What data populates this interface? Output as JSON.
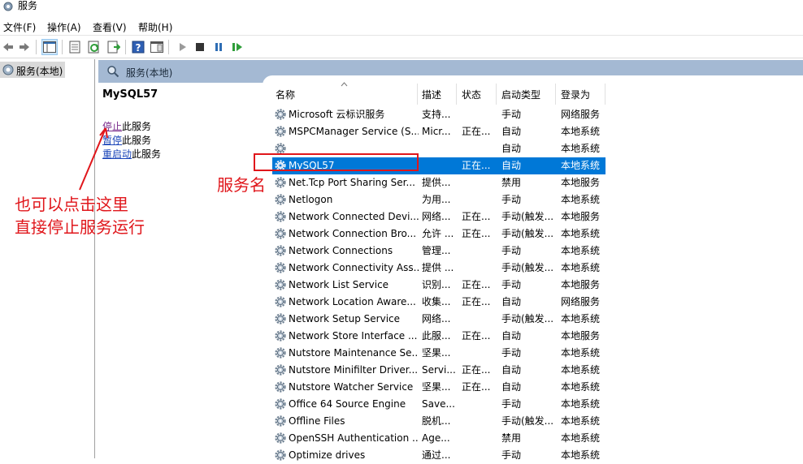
{
  "window": {
    "title": "服务"
  },
  "menu": [
    "文件(F)",
    "操作(A)",
    "查看(V)",
    "帮助(H)"
  ],
  "toolbar": {
    "icons": [
      "back-arrow-icon",
      "forward-arrow-icon",
      "show-tree-icon",
      "properties-icon",
      "refresh-icon",
      "export-icon",
      "help-icon",
      "console-icon",
      "start-icon",
      "stop-icon",
      "pause-icon",
      "restart-icon"
    ]
  },
  "tree": {
    "node_label": "服务(本地)"
  },
  "content_header": {
    "label": "服务(本地)"
  },
  "description": {
    "service_name": "MySQL57",
    "stop_link": "停止",
    "stop_suffix": "此服务",
    "pause_link": "暂停",
    "pause_suffix": "此服务",
    "restart_link": "重启动",
    "restart_suffix": "此服务"
  },
  "columns": [
    "名称",
    "描述",
    "状态",
    "启动类型",
    "登录为"
  ],
  "rows": [
    {
      "name": "Microsoft 云标识服务",
      "desc": "支持...",
      "status": "",
      "startup": "手动",
      "logon": "网络服务"
    },
    {
      "name": "MSPCManager Service (S...",
      "desc": "Micr...",
      "status": "正在...",
      "startup": "自动",
      "logon": "本地系统"
    },
    {
      "name": "",
      "desc": "",
      "status": "",
      "startup": "自动",
      "logon": "本地系统"
    },
    {
      "name": "MySQL57",
      "desc": "",
      "status": "正在...",
      "startup": "自动",
      "logon": "本地系统",
      "selected": true
    },
    {
      "name": "Net.Tcp Port Sharing Ser...",
      "desc": "提供...",
      "status": "",
      "startup": "禁用",
      "logon": "本地服务"
    },
    {
      "name": "Netlogon",
      "desc": "为用...",
      "status": "",
      "startup": "手动",
      "logon": "本地系统"
    },
    {
      "name": "Network Connected Devi...",
      "desc": "网络...",
      "status": "正在...",
      "startup": "手动(触发...",
      "logon": "本地服务"
    },
    {
      "name": "Network Connection Bro...",
      "desc": "允许 ...",
      "status": "正在...",
      "startup": "手动(触发...",
      "logon": "本地系统"
    },
    {
      "name": "Network Connections",
      "desc": "管理...",
      "status": "",
      "startup": "手动",
      "logon": "本地系统"
    },
    {
      "name": "Network Connectivity Ass...",
      "desc": "提供 ...",
      "status": "",
      "startup": "手动(触发...",
      "logon": "本地系统"
    },
    {
      "name": "Network List Service",
      "desc": "识别...",
      "status": "正在...",
      "startup": "手动",
      "logon": "本地服务"
    },
    {
      "name": "Network Location Aware...",
      "desc": "收集...",
      "status": "正在...",
      "startup": "自动",
      "logon": "网络服务"
    },
    {
      "name": "Network Setup Service",
      "desc": "网络...",
      "status": "",
      "startup": "手动(触发...",
      "logon": "本地系统"
    },
    {
      "name": "Network Store Interface ...",
      "desc": "此服...",
      "status": "正在...",
      "startup": "自动",
      "logon": "本地服务"
    },
    {
      "name": "Nutstore Maintenance Se...",
      "desc": "坚果...",
      "status": "",
      "startup": "手动",
      "logon": "本地系统"
    },
    {
      "name": "Nutstore Minifilter Driver...",
      "desc": "Servi...",
      "status": "正在...",
      "startup": "自动",
      "logon": "本地系统"
    },
    {
      "name": "Nutstore Watcher Service",
      "desc": "坚果...",
      "status": "正在...",
      "startup": "自动",
      "logon": "本地系统"
    },
    {
      "name": "Office 64 Source Engine",
      "desc": "Save...",
      "status": "",
      "startup": "手动",
      "logon": "本地系统"
    },
    {
      "name": "Offline Files",
      "desc": "脱机...",
      "status": "",
      "startup": "手动(触发...",
      "logon": "本地系统"
    },
    {
      "name": "OpenSSH Authentication ...",
      "desc": "Age...",
      "status": "",
      "startup": "禁用",
      "logon": "本地系统"
    },
    {
      "name": "Optimize drives",
      "desc": "通过...",
      "status": "",
      "startup": "手动",
      "logon": "本地系统"
    }
  ],
  "annotations": {
    "service_name_label": "服务名",
    "hint_line1": "也可以点击这里",
    "hint_line2": "直接停止服务运行"
  },
  "colors": {
    "selection": "#0078d7",
    "header": "#a4b9d3",
    "annotation": "#e0161b",
    "link": "#1a44b8"
  }
}
